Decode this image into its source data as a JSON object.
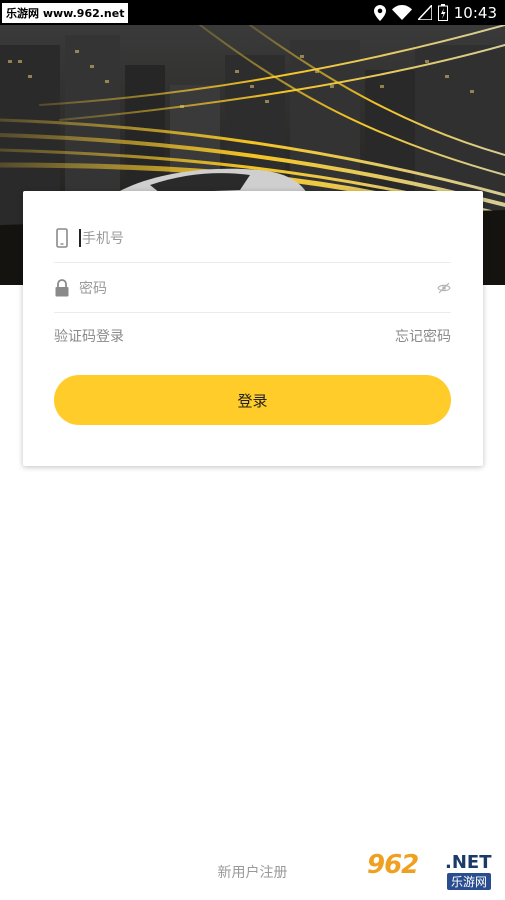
{
  "status_bar": {
    "site_label": "乐游网 www.962.net",
    "time": "10:43",
    "icons": [
      "location-icon",
      "wifi-icon",
      "no-signal-icon",
      "battery-icon"
    ]
  },
  "login": {
    "phone_placeholder": "手机号",
    "password_placeholder": "密码",
    "code_login_link": "验证码登录",
    "forgot_password_link": "忘记密码",
    "login_button": "登录"
  },
  "footer": {
    "register_link": "新用户注册"
  },
  "watermark": {
    "main": "962",
    "suffix": ".NET",
    "sub": "乐游网"
  },
  "colors": {
    "accent": "#ffcc29",
    "placeholder": "#9a9a9a"
  }
}
